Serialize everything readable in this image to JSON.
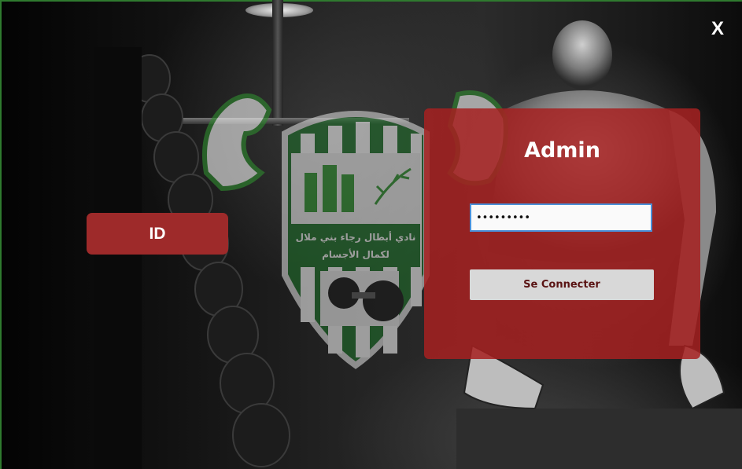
{
  "window": {
    "close_label": "X"
  },
  "id_button": {
    "label": "ID"
  },
  "login": {
    "title": "Admin",
    "password_value": "•••••••••",
    "connect_label": "Se Connecter"
  },
  "crest": {
    "line1": "نادي أبطال رجاء بني ملال",
    "line2": "لكمال الأجسام"
  },
  "colors": {
    "panel": "#a52121",
    "id_button": "#9e2a2a",
    "accent_green": "#2f8a2f",
    "button_text": "#5a1414"
  },
  "icons": [
    "close-icon",
    "club-crest-logo",
    "flexed-arm-icon",
    "dumbbell-icon",
    "olive-branch-icon",
    "castle-icon"
  ]
}
